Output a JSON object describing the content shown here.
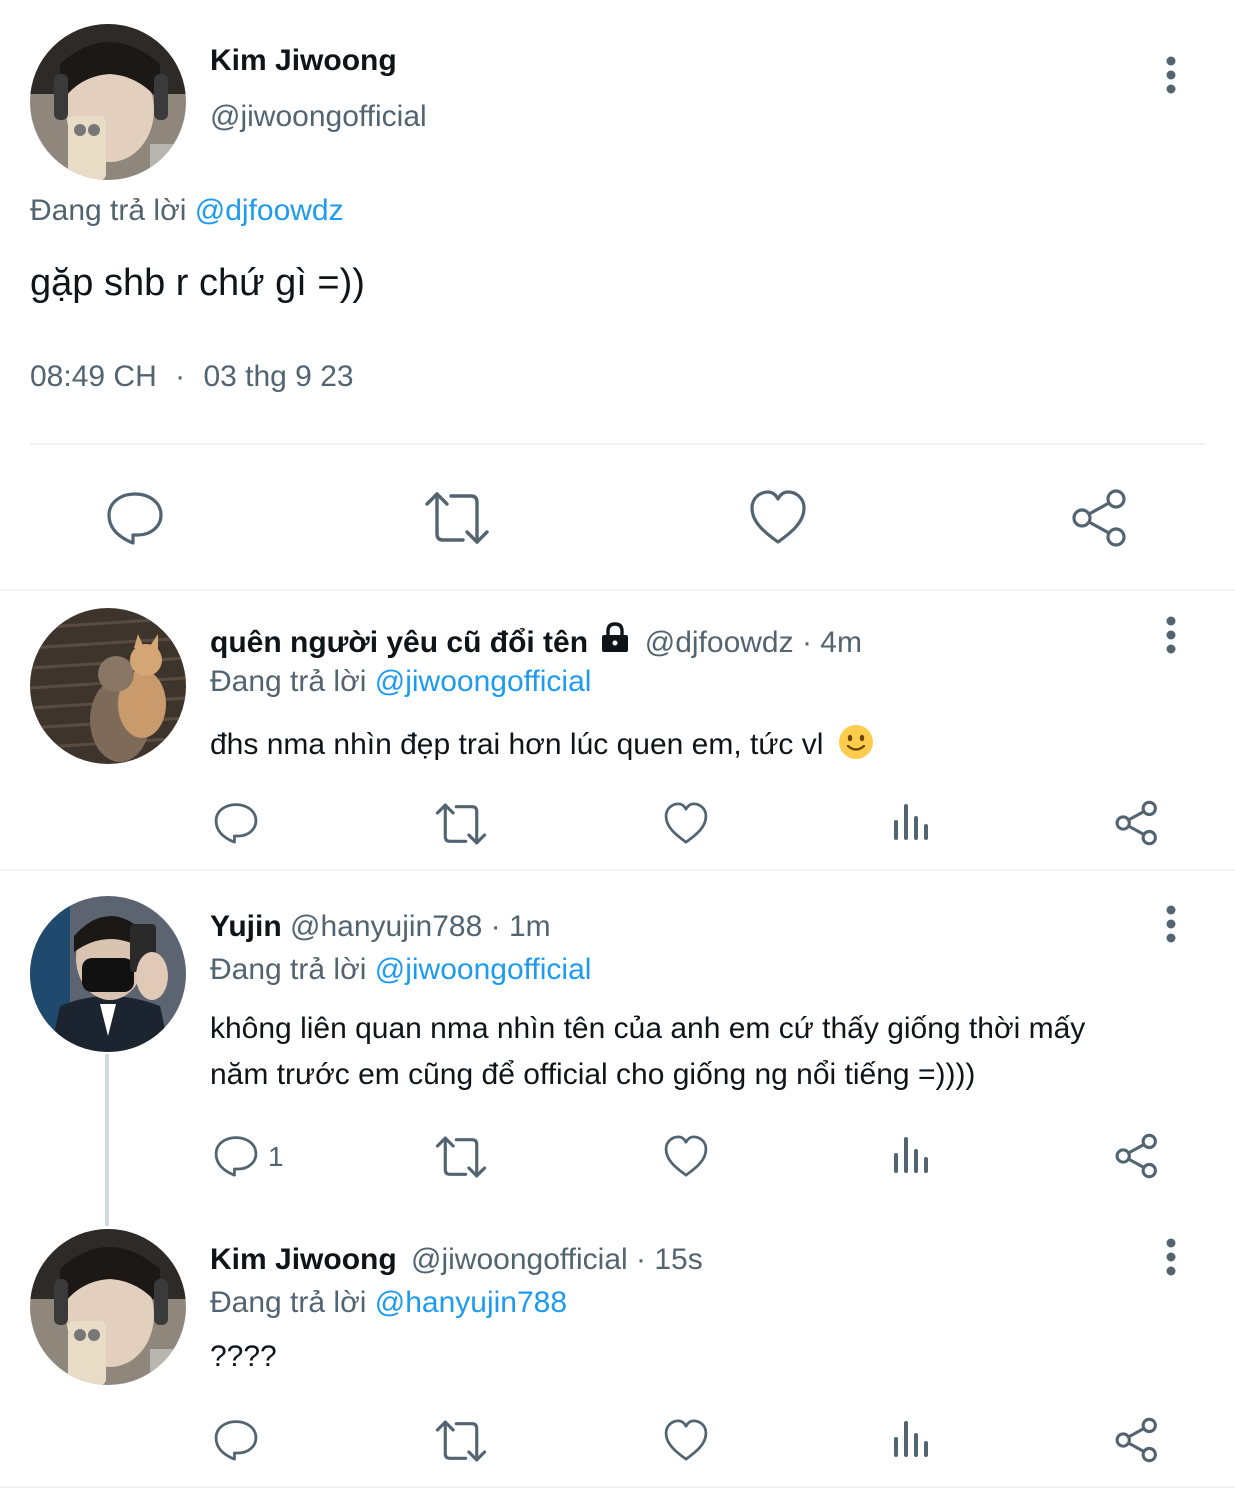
{
  "main_tweet": {
    "display_name": "Kim Jiwoong",
    "handle": "@jiwoongofficial",
    "replying_prefix": "Đang trả lời",
    "replying_to": "@djfoowdz",
    "text": "gặp shb r chứ gì =))",
    "time": "08:49 CH",
    "separator": "·",
    "date": "03 thg 9 23"
  },
  "replies": [
    {
      "display_name": "quên người yêu cũ đổi tên",
      "handle": "@djfoowdz",
      "age": "· 4m",
      "replying_prefix": "Đang trả lời",
      "replying_to": "@jiwoongofficial",
      "text": "đhs nma nhìn đẹp trai hơn lúc quen em, tức vl",
      "protected": true,
      "emoji": "slightly-smiling-face"
    },
    {
      "display_name": "Yujin",
      "handle": "@hanyujin788",
      "age": "· 1m",
      "replying_prefix": "Đang trả lời",
      "replying_to": "@jiwoongofficial",
      "text_line1": "không liên quan nma nhìn tên của anh em cứ thấy giống thời mấy",
      "text_line2": "năm trước em cũng để official cho giống ng nổi tiếng =))))",
      "reply_count": "1"
    },
    {
      "display_name": "Kim Jiwoong",
      "handle": "@jiwoongofficial",
      "age": "· 15s",
      "replying_prefix": "Đang trả lời",
      "replying_to": "@hanyujin788",
      "text": "????"
    }
  ],
  "colors": {
    "text": "#0f1419",
    "muted": "#536471",
    "link": "#1d9bf0",
    "divider": "#eff3f4"
  }
}
